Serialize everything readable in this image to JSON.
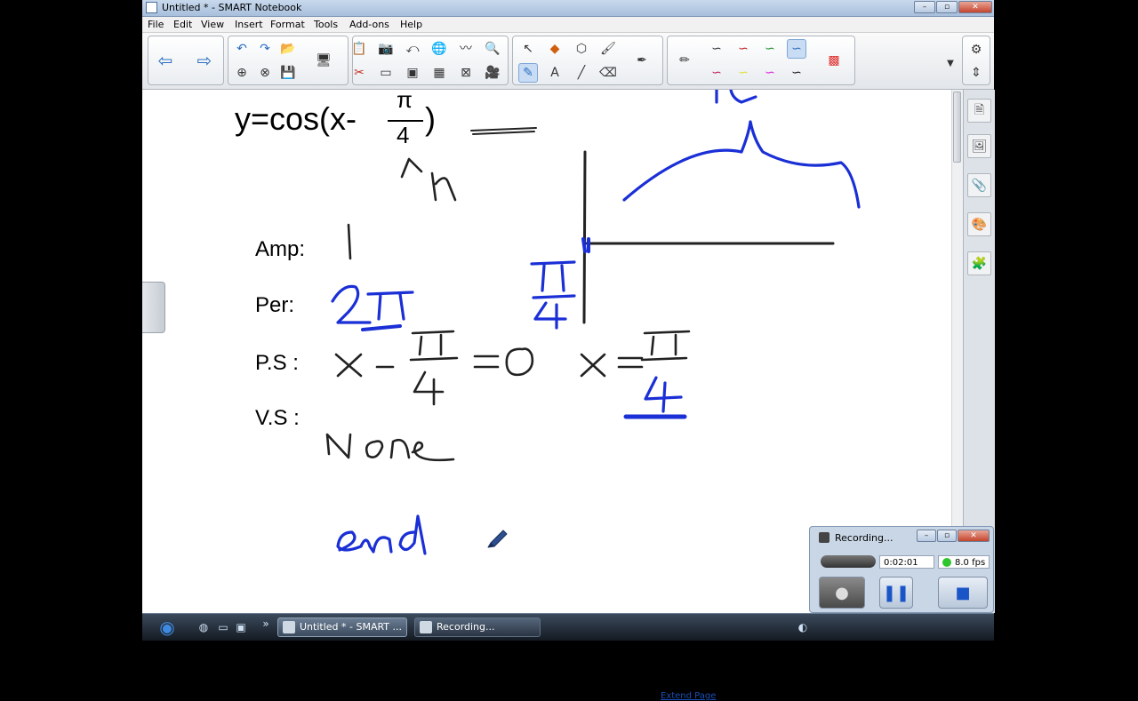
{
  "window": {
    "title": "Untitled * - SMART Notebook"
  },
  "menu": [
    "File",
    "Edit",
    "View",
    "Insert",
    "Format",
    "Tools",
    "Add-ons",
    "Help"
  ],
  "page": {
    "equation_left": "y=cos(x-",
    "fraction_num": "π",
    "fraction_den": "4",
    "equation_right": ")",
    "label_amp": "Amp:",
    "label_per": "Per:",
    "label_ps": "P.S :",
    "label_vs": "V.S :",
    "extend_link": "Extend Page"
  },
  "recorder": {
    "title": "Recording...",
    "time": "0:02:01",
    "fps": "8.0 fps"
  },
  "taskbar": {
    "task1": "Untitled * - SMART ...",
    "task2": "Recording..."
  },
  "colors": {
    "ink_blue": "#1a2fd6",
    "ink_black": "#222222",
    "page": "#ffffff"
  }
}
